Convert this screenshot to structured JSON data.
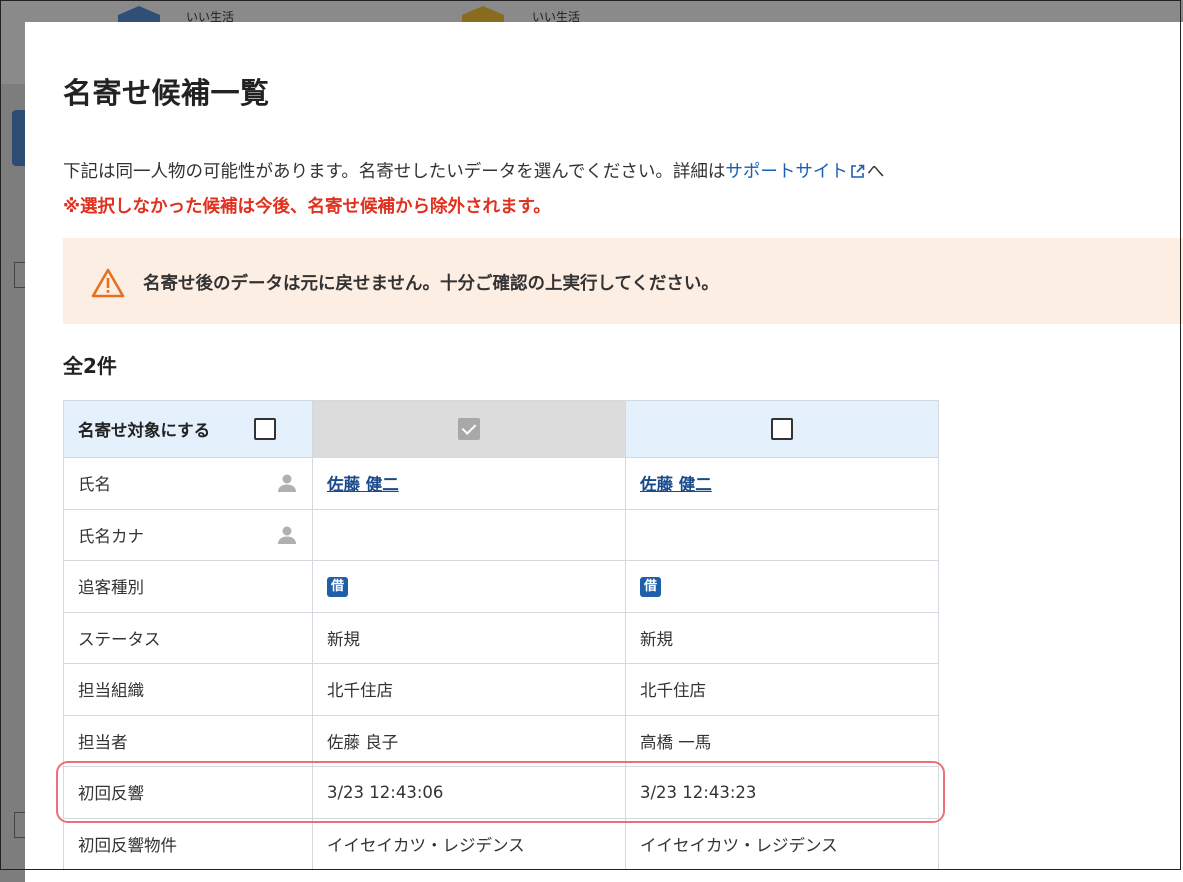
{
  "background": {
    "logo1_text": "いい生活",
    "logo2_text": "いい生活"
  },
  "modal": {
    "title": "名寄せ候補一覧",
    "description_before": "下記は同一人物の可能性があります。名寄せしたいデータを選んでください。詳細は",
    "support_link": "サポートサイト",
    "description_after": "へ",
    "warning_red": "※選択しなかった候補は今後、名寄せ候補から除外されます。",
    "alert": "名寄せ後のデータは元に戻せません。十分ご確認の上実行してください。",
    "count": "全2件"
  },
  "table": {
    "header_label": "名寄せ対象にする",
    "header_checked": [
      true,
      false
    ],
    "rows": [
      {
        "label": "氏名",
        "person_icon": true,
        "a": "佐藤 健二",
        "b": "佐藤 健二"
      },
      {
        "label": "氏名カナ",
        "person_icon": true,
        "a": "",
        "b": ""
      },
      {
        "label": "追客種別",
        "a": "借",
        "b": "借"
      },
      {
        "label": "ステータス",
        "a": "新規",
        "b": "新規"
      },
      {
        "label": "担当組織",
        "a": "北千住店",
        "b": "北千住店"
      },
      {
        "label": "担当者",
        "a": "佐藤 良子",
        "b": "高橋 一馬"
      },
      {
        "label": "初回反響",
        "a": "3/23 12:43:06",
        "b": "3/23 12:43:23"
      },
      {
        "label": "初回反響物件",
        "a": "イイセイカツ・レジデンス",
        "b": "イイセイカツ・レジデンス"
      }
    ]
  },
  "colors": {
    "accent_link": "#1a5fb4",
    "warning_red": "#e0301e",
    "alert_bg": "#fdeee4",
    "alert_icon": "#e5701f",
    "tag_bg": "#1f5fa8",
    "highlight": "#ee6f7a"
  }
}
